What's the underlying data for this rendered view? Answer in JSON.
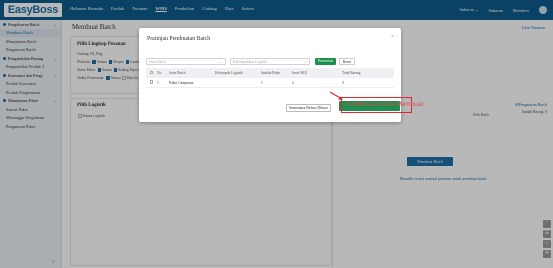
{
  "app": {
    "logo": "EasyBoss"
  },
  "topnav": [
    "Halaman Beranda",
    "Produk",
    "Pesanan",
    "WMS",
    "Pembelian",
    "Gudang",
    "Data",
    "Sistem"
  ],
  "topnav_active": "WMS",
  "topright": {
    "item1": "Sukuran ⌄",
    "item2": "Sukuran",
    "item3": "Members"
  },
  "sidebar": {
    "rows": [
      {
        "label": "Pengeluaran Batch",
        "kind": "group",
        "chev": "⌄"
      },
      {
        "label": "Membuat Batch",
        "kind": "sub",
        "active": true
      },
      {
        "label": "Manajemen Batch",
        "kind": "sub"
      },
      {
        "label": "Pengaturan Batch",
        "kind": "sub"
      },
      {
        "label": "Pengambilan Barang",
        "kind": "group",
        "chev": "⌄"
      },
      {
        "label": "Pengambilan Produk T",
        "kind": "sub"
      },
      {
        "label": "Konsumsi dan Pengi",
        "kind": "group",
        "chev": "⌄"
      },
      {
        "label": "Produk Konsumsi",
        "kind": "sub"
      },
      {
        "label": "Produk Pengemasan",
        "kind": "sub"
      },
      {
        "label": "Manajemen Paket",
        "kind": "group",
        "chev": "⌄"
      },
      {
        "label": "Semua Paket",
        "kind": "sub"
      },
      {
        "label": "Menunggu Pengiriman",
        "kind": "sub"
      },
      {
        "label": "Pengaturan Paket",
        "kind": "sub"
      }
    ],
    "collapse_icon": "≡"
  },
  "main": {
    "title": "Membuat Batch",
    "help": "Lihat Panduan",
    "card1": {
      "title": "Pilih Lingkup Pesanan",
      "line1": "Gudang: ID_Plug",
      "line2_label": "Platform:",
      "line2_items": [
        "Semua",
        "Shopee",
        "Lazada"
      ],
      "line3_label": "Status Paket:",
      "line3_items": [
        "Semua",
        "Sedang Diproses"
      ],
      "line4_label": "Waktu Pemesanan:",
      "line4_items": [
        "Semua",
        "Hari Ini"
      ]
    },
    "card2": {
      "title": "Pilih Logistik",
      "item": "Semua Logistik"
    },
    "right": {
      "header_link": "Pengaturan Batch",
      "jumlah_label": "Jumlah Barang:",
      "jumlah_value": "0",
      "select_label": "Pilih Batch",
      "btn": "Membuat Batch",
      "hint": "Memilih secara manual pesanan untuk membuat batch"
    },
    "side_icons": [
      "⌃",
      "☰",
      "⌂",
      "✉"
    ]
  },
  "modal": {
    "title": "Pratinjau Pembuatan Batch",
    "close": "×",
    "filter1_placeholder": "Jenis Batch",
    "filter2_placeholder": "Kelompokkan Logistik",
    "search": "Pencarian",
    "reset": "Reset",
    "columns": [
      "No",
      "Jenis Batch",
      "Kelompok Logistik",
      "Jumlah Paket",
      "Jenis SKU",
      "Total Barang"
    ],
    "rows": [
      {
        "no": "1",
        "jenis": "Paket Campuran",
        "kelompok": "",
        "paket": "1",
        "sku": "2",
        "total": "3"
      }
    ],
    "btn_cancel": "Sementara Belum Dibuat",
    "btn_confirm": "Konfirmasi untuk Membuat"
  },
  "colors": {
    "primary": "#1d6fa5",
    "confirm": "#1d8f4e",
    "highlight": "#e0282e"
  }
}
